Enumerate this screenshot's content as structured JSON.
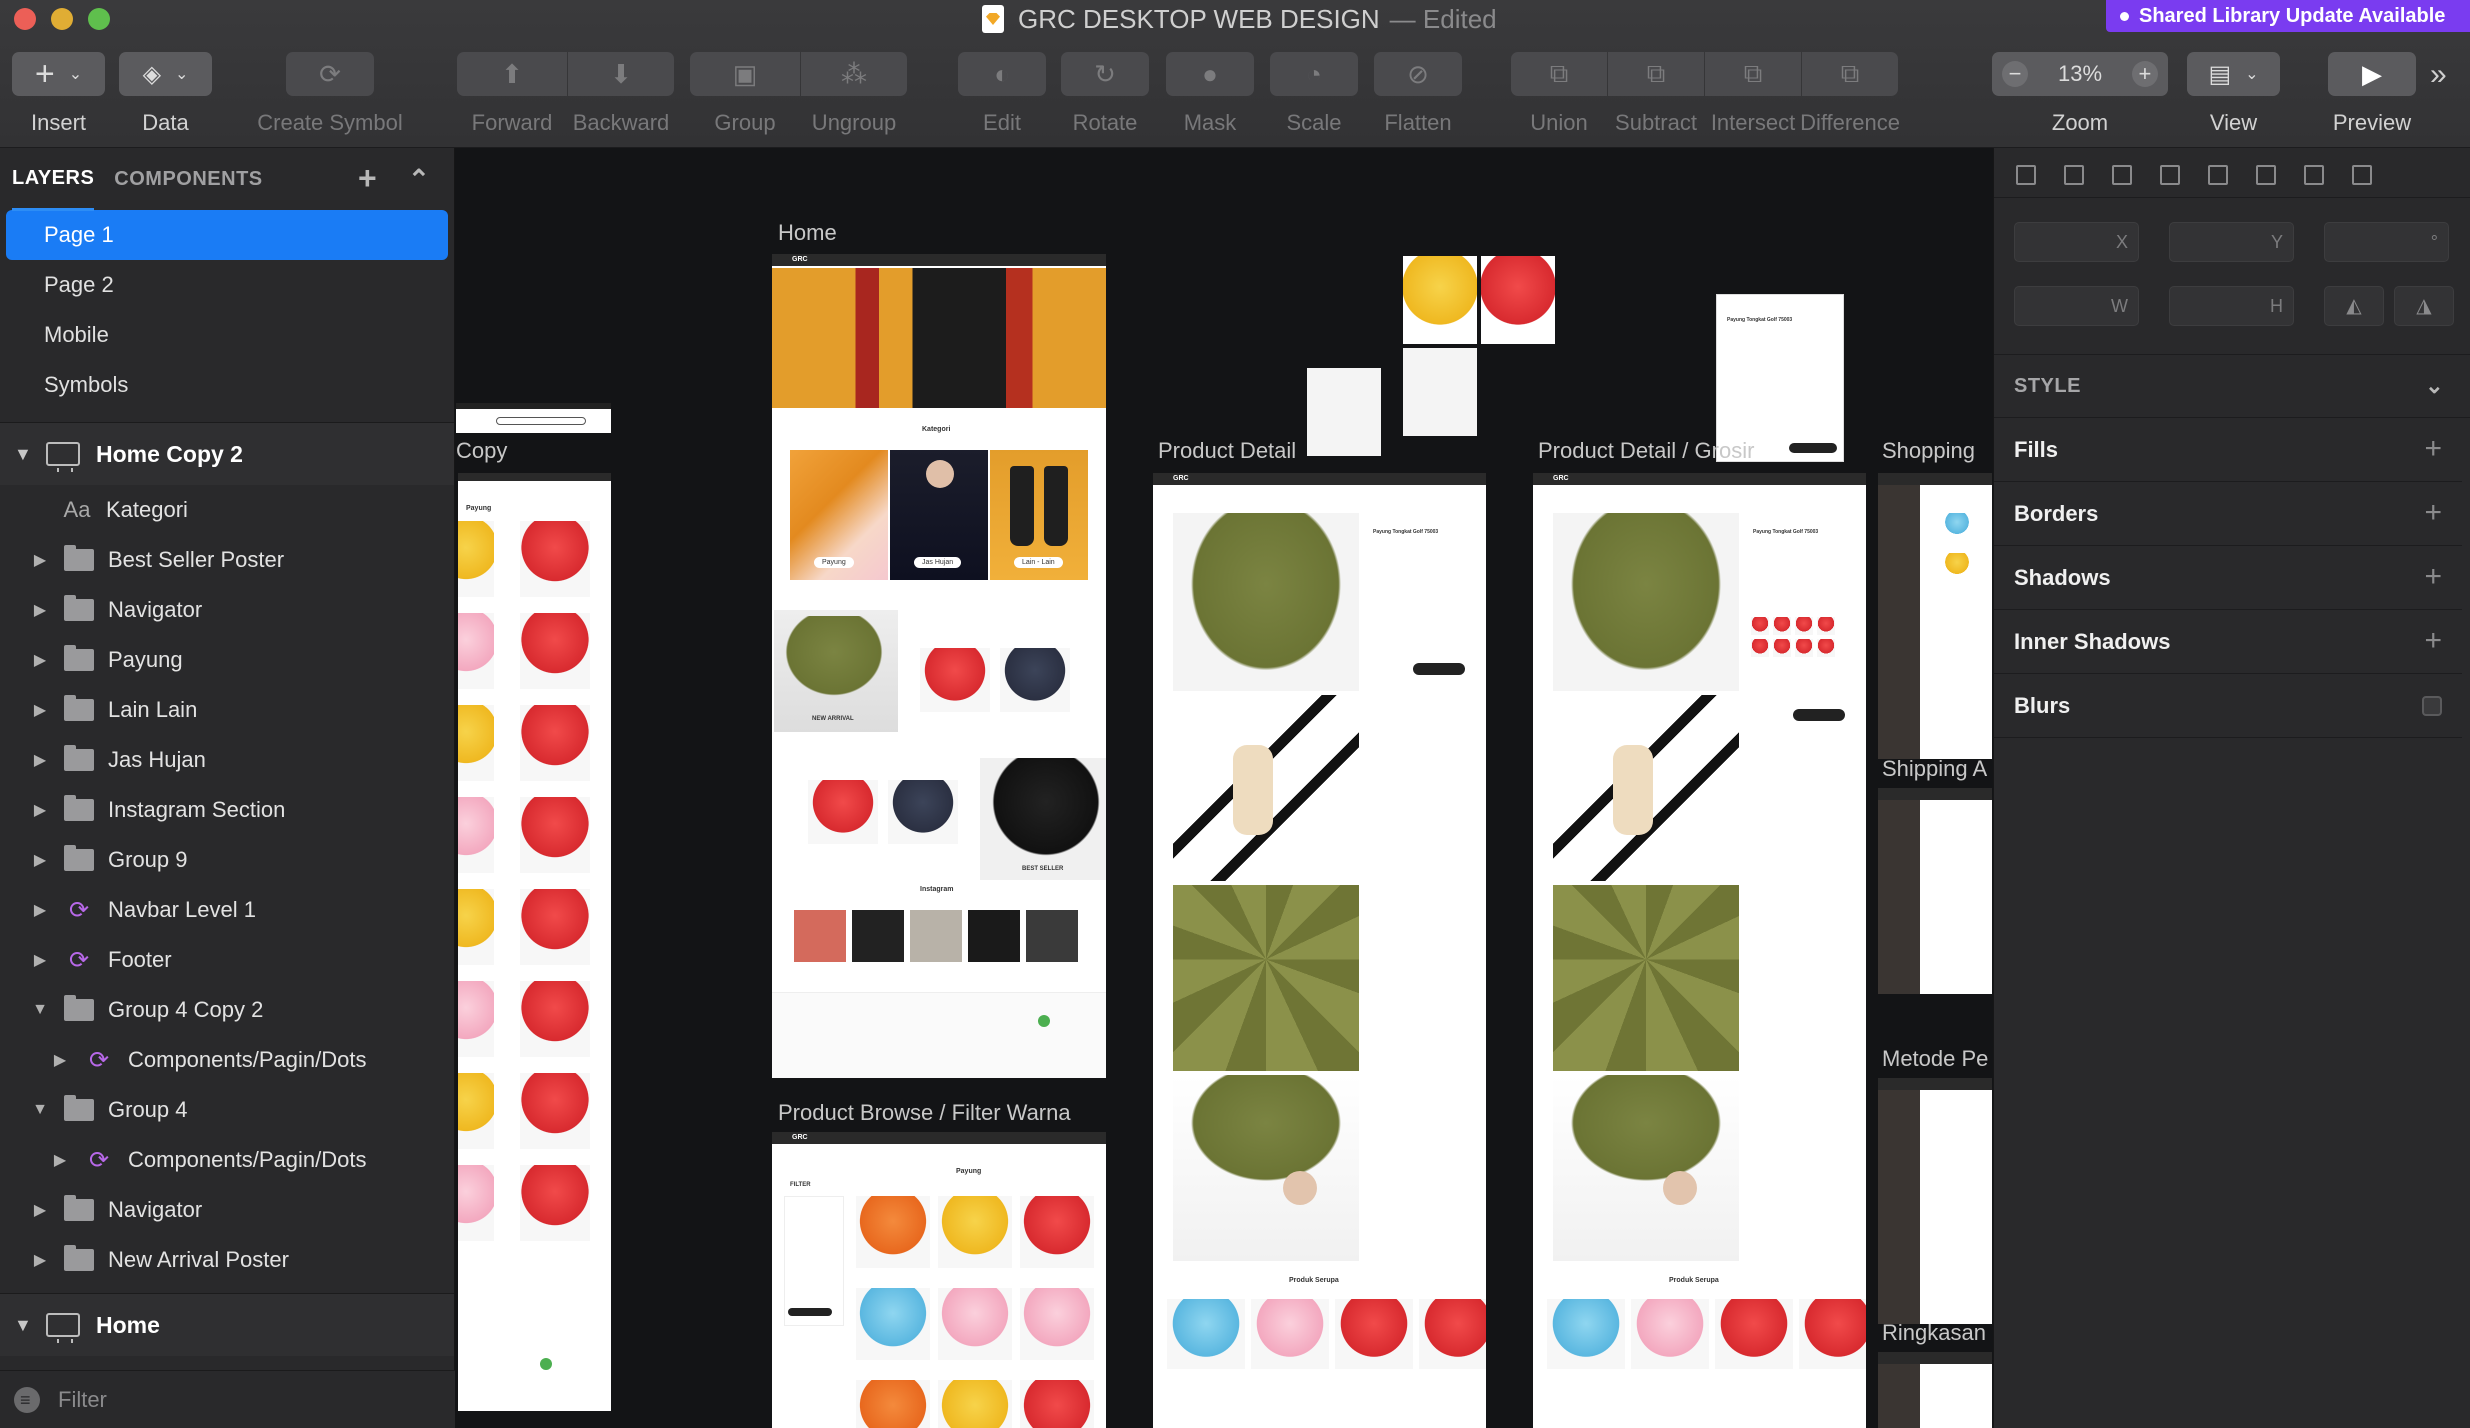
{
  "window": {
    "title": "GRC DESKTOP WEB DESIGN",
    "status": "— Edited",
    "badge": "Shared Library Update Available"
  },
  "toolbar": {
    "insert": "Insert",
    "data": "Data",
    "create_symbol": "Create Symbol",
    "forward": "Forward",
    "backward": "Backward",
    "group": "Group",
    "ungroup": "Ungroup",
    "edit": "Edit",
    "rotate": "Rotate",
    "mask": "Mask",
    "scale": "Scale",
    "flatten": "Flatten",
    "union": "Union",
    "subtract": "Subtract",
    "intersect": "Intersect",
    "difference": "Difference",
    "zoom_value": "13%",
    "zoom": "Zoom",
    "view": "View",
    "preview": "Preview",
    "zoom_out_glyph": "−",
    "zoom_in_glyph": "+",
    "overflow_glyph": "»"
  },
  "left_panel": {
    "tab_layers": "LAYERS",
    "tab_components": "COMPONENTS",
    "pages": [
      "Page 1",
      "Page 2",
      "Mobile",
      "Symbols"
    ],
    "artboard_1": "Home Copy 2",
    "layers": [
      {
        "label": "Kategori",
        "kind": "text"
      },
      {
        "label": "Best Seller Poster",
        "kind": "folder"
      },
      {
        "label": "Navigator",
        "kind": "folder"
      },
      {
        "label": "Payung",
        "kind": "folder"
      },
      {
        "label": "Lain Lain",
        "kind": "folder"
      },
      {
        "label": "Jas Hujan",
        "kind": "folder"
      },
      {
        "label": "Instagram Section",
        "kind": "folder"
      },
      {
        "label": "Group 9",
        "kind": "folder"
      },
      {
        "label": "Navbar Level 1",
        "kind": "symbol"
      },
      {
        "label": "Footer",
        "kind": "symbol"
      },
      {
        "label": "Group 4 Copy 2",
        "kind": "folder-open"
      },
      {
        "label": "Components/Pagin/Dots",
        "kind": "symbol-nested"
      },
      {
        "label": "Group 4",
        "kind": "folder-open"
      },
      {
        "label": "Components/Pagin/Dots",
        "kind": "symbol-nested"
      },
      {
        "label": "Navigator",
        "kind": "folder"
      },
      {
        "label": "New Arrival Poster",
        "kind": "folder"
      }
    ],
    "artboard_2": "Home",
    "filter": "Filter"
  },
  "canvas": {
    "labels": {
      "copy": "Copy",
      "home": "Home",
      "product_detail": "Product Detail",
      "product_detail_grosir": "Product Detail / Grosir",
      "shopping": "Shopping",
      "shipping": "Shipping A",
      "metode": "Metode Pe",
      "ringkasan": "Ringkasan",
      "browse": "Product Browse / Filter Warna"
    },
    "mock": {
      "kategori": "Kategori",
      "instagram": "Instagram",
      "new_arrival": "NEW ARRIVAL",
      "best_seller": "BEST SELLER",
      "produk_serupa": "Produk Serupa",
      "payung": "Payung",
      "filter": "FILTER",
      "logo": "GRC",
      "cat_1": "Payung",
      "cat_2": "Jas Hujan",
      "cat_3": "Lain - Lain",
      "product_name": "Payung Tongkat Golf 75003"
    }
  },
  "inspector": {
    "x": "X",
    "y": "Y",
    "rotation": "°",
    "w": "W",
    "h": "H",
    "style": "STYLE",
    "fills": "Fills",
    "borders": "Borders",
    "shadows": "Shadows",
    "inner_shadows": "Inner Shadows",
    "blurs": "Blurs"
  }
}
